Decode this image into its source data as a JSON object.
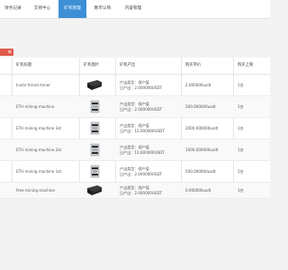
{
  "top_tabs": [
    {
      "label": "财务记录",
      "active": false
    },
    {
      "label": "交易中心",
      "active": false
    },
    {
      "label": "矿机管理",
      "active": true
    },
    {
      "label": "数币认购",
      "active": false
    },
    {
      "label": "内容管理",
      "active": false
    }
  ],
  "toolbar": {
    "add_label": "新"
  },
  "table": {
    "headers": [
      "矿机标题",
      "矿机图片",
      "矿机产出",
      "购买单价",
      "购买上限"
    ],
    "output_type_prefix": "产出类型：",
    "output_amount_prefix": "日产出：",
    "rows": [
      {
        "title": "Invite friend miner",
        "image": "black",
        "output_type": "保产值",
        "daily_output": "2.000000USDT",
        "price": "2.000000usdt",
        "limit": "1台"
      },
      {
        "title": "ETH mining machine",
        "image": "silver",
        "output_type": "保产值",
        "daily_output": "2.000000USDT",
        "price": "200.000000usdt",
        "limit": "1台"
      },
      {
        "title": "ETH mining machine 3st",
        "image": "silver",
        "output_type": "保产值",
        "daily_output": "12.000000USDT",
        "price": "2000.000000usdt",
        "limit": "1台"
      },
      {
        "title": "ETH mining machine 2st",
        "image": "silver",
        "output_type": "保产值",
        "daily_output": "13.000000USDT",
        "price": "1000.000000usdt",
        "limit": "1台"
      },
      {
        "title": "ETH mining machine 1st",
        "image": "silver",
        "output_type": "保产值",
        "daily_output": "2.000000USDT",
        "price": "500.000000usdt",
        "limit": "1台"
      },
      {
        "title": "Free mining machine",
        "image": "black",
        "output_type": "保产值",
        "daily_output": "2.000000USDT",
        "price": "0.000000usdt",
        "limit": "1台"
      }
    ]
  }
}
